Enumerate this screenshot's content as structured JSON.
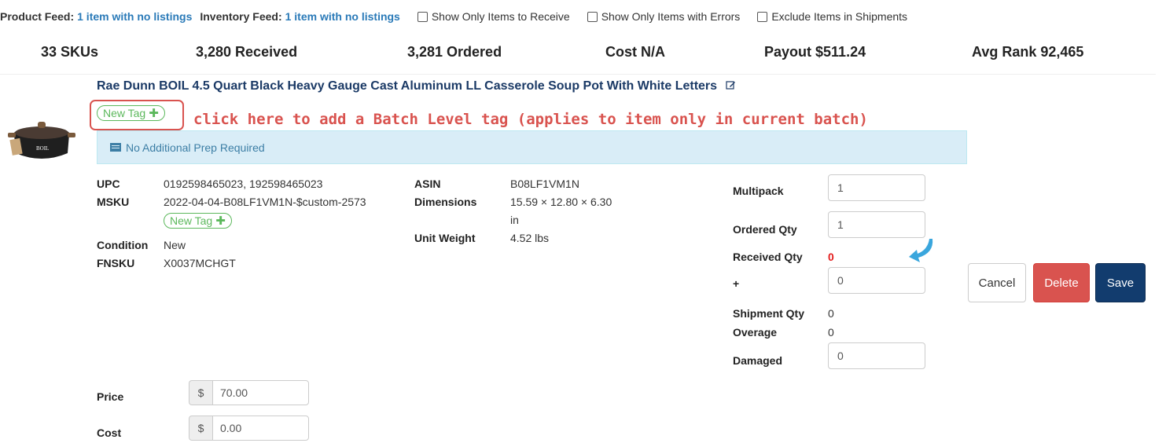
{
  "feed": {
    "product_label": "Product Feed:",
    "product_link": "1 item with no listings",
    "inventory_label": "Inventory Feed:",
    "inventory_link": "1 item with no listings",
    "filters": [
      "Show Only Items to Receive",
      "Show Only Items with Errors",
      "Exclude Items in Shipments"
    ]
  },
  "stats": {
    "skus": "33 SKUs",
    "received": "3,280 Received",
    "ordered": "3,281 Ordered",
    "cost": "Cost N/A",
    "payout": "Payout $511.24",
    "avg_rank": "Avg Rank 92,465"
  },
  "item": {
    "title": "Rae Dunn BOIL 4.5 Quart Black Heavy Gauge Cast Aluminum LL Casserole Soup Pot With White Letters",
    "tag_label": "New Tag",
    "annotation": "click here to add a Batch Level tag (applies to item only in current batch)",
    "prep_note": "No Additional Prep Required",
    "details": {
      "upc_label": "UPC",
      "upc_value": "0192598465023, 192598465023",
      "msku_label": "MSKU",
      "msku_value": "2022-04-04-B08LF1VM1N-$custom-2573",
      "msku_tag_label": "New Tag",
      "condition_label": "Condition",
      "condition_value": "New",
      "fnsku_label": "FNSKU",
      "fnsku_value": "X0037MCHGT",
      "asin_label": "ASIN",
      "asin_value": "B08LF1VM1N",
      "dimensions_label": "Dimensions",
      "dimensions_value": "15.59 × 12.80 × 6.30",
      "dimensions_unit": "in",
      "weight_label": "Unit Weight",
      "weight_value": "4.52 lbs"
    },
    "quantities": {
      "multipack_label": "Multipack",
      "multipack_value": "1",
      "ordered_label": "Ordered Qty",
      "ordered_value": "1",
      "received_label": "Received Qty",
      "received_value": "0",
      "plus_label": "+",
      "plus_value": "0",
      "shipment_label": "Shipment Qty",
      "shipment_value": "0",
      "overage_label": "Overage",
      "overage_value": "0",
      "damaged_label": "Damaged",
      "damaged_value": "0"
    },
    "pricing": {
      "price_label": "Price",
      "price_value": "70.00",
      "cost_label": "Cost",
      "cost_value": "0.00",
      "currency": "$"
    },
    "buttons": {
      "cancel": "Cancel",
      "delete": "Delete",
      "save": "Save"
    }
  },
  "colors": {
    "link": "#2a7ab8",
    "title": "#1b3a66",
    "tag_green": "#5cb85c",
    "annotation_red": "#d9534f",
    "prep_bg": "#d9edf7",
    "delete": "#d9534f",
    "save": "#123c6e"
  }
}
